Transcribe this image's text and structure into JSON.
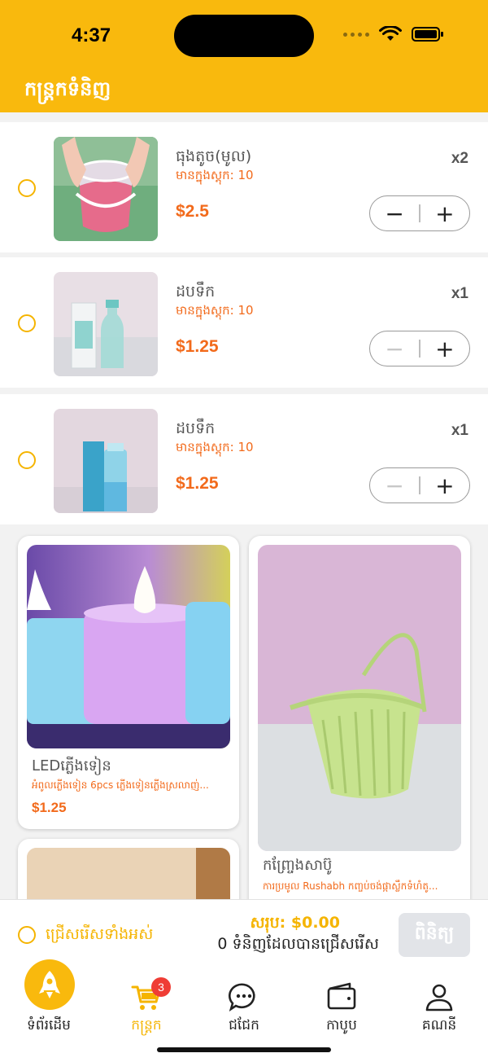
{
  "status_bar": {
    "time": "4:37"
  },
  "header": {
    "title": "កន្ត្រកទំនិញ"
  },
  "cart_items": [
    {
      "name": "ធុងតូច(មូល)",
      "stock": "មានក្នុងស្តុក: 10",
      "price": "$2.5",
      "qty": "x2",
      "minus": "−",
      "plus": "+",
      "minus_enabled": true
    },
    {
      "name": "ដបទឹក",
      "stock": "មានក្នុងស្តុក: 10",
      "price": "$1.25",
      "qty": "x1",
      "minus": "−",
      "plus": "+",
      "minus_enabled": false
    },
    {
      "name": "ដបទឹក",
      "stock": "មានក្នុងស្តុក: 10",
      "price": "$1.25",
      "qty": "x1",
      "minus": "−",
      "plus": "+",
      "minus_enabled": false
    }
  ],
  "recommendations": [
    {
      "name": "LEDភ្លើងទៀន",
      "desc": "អំពូលភ្លើងទៀន 6pcs ភ្លើងទៀនភ្លើងស្រលាញ់...",
      "price": "$1.25"
    },
    {
      "name": "កញ្ច្រែងសាប៊ូ",
      "desc": "ការប្រមូល Rushabh កញ្ចប់ចង់ផ្កាស្លឹកទំហំតូ..."
    },
    {
      "name": ""
    }
  ],
  "checkout": {
    "select_all": "ជ្រើសរើសទាំងអស់",
    "total": "សរុប: $0.00",
    "selected_count": "0 ទំនិញដែលបានជ្រើសរើស",
    "pay": "ពិនិត្យ"
  },
  "tabbar": {
    "items": [
      {
        "label": "ទំព័រដើម",
        "icon": "rocket-icon"
      },
      {
        "label": "កន្ត្រក",
        "icon": "cart-icon",
        "badge": "3",
        "active": true
      },
      {
        "label": "ជជែក",
        "icon": "chat-icon"
      },
      {
        "label": "កាបូប",
        "icon": "wallet-icon"
      },
      {
        "label": "គណនី",
        "icon": "user-icon"
      }
    ]
  },
  "colors": {
    "brand": "#f9b90d",
    "accent": "#f26a1b",
    "radio": "#f5b400",
    "badge": "#ef3d35"
  }
}
